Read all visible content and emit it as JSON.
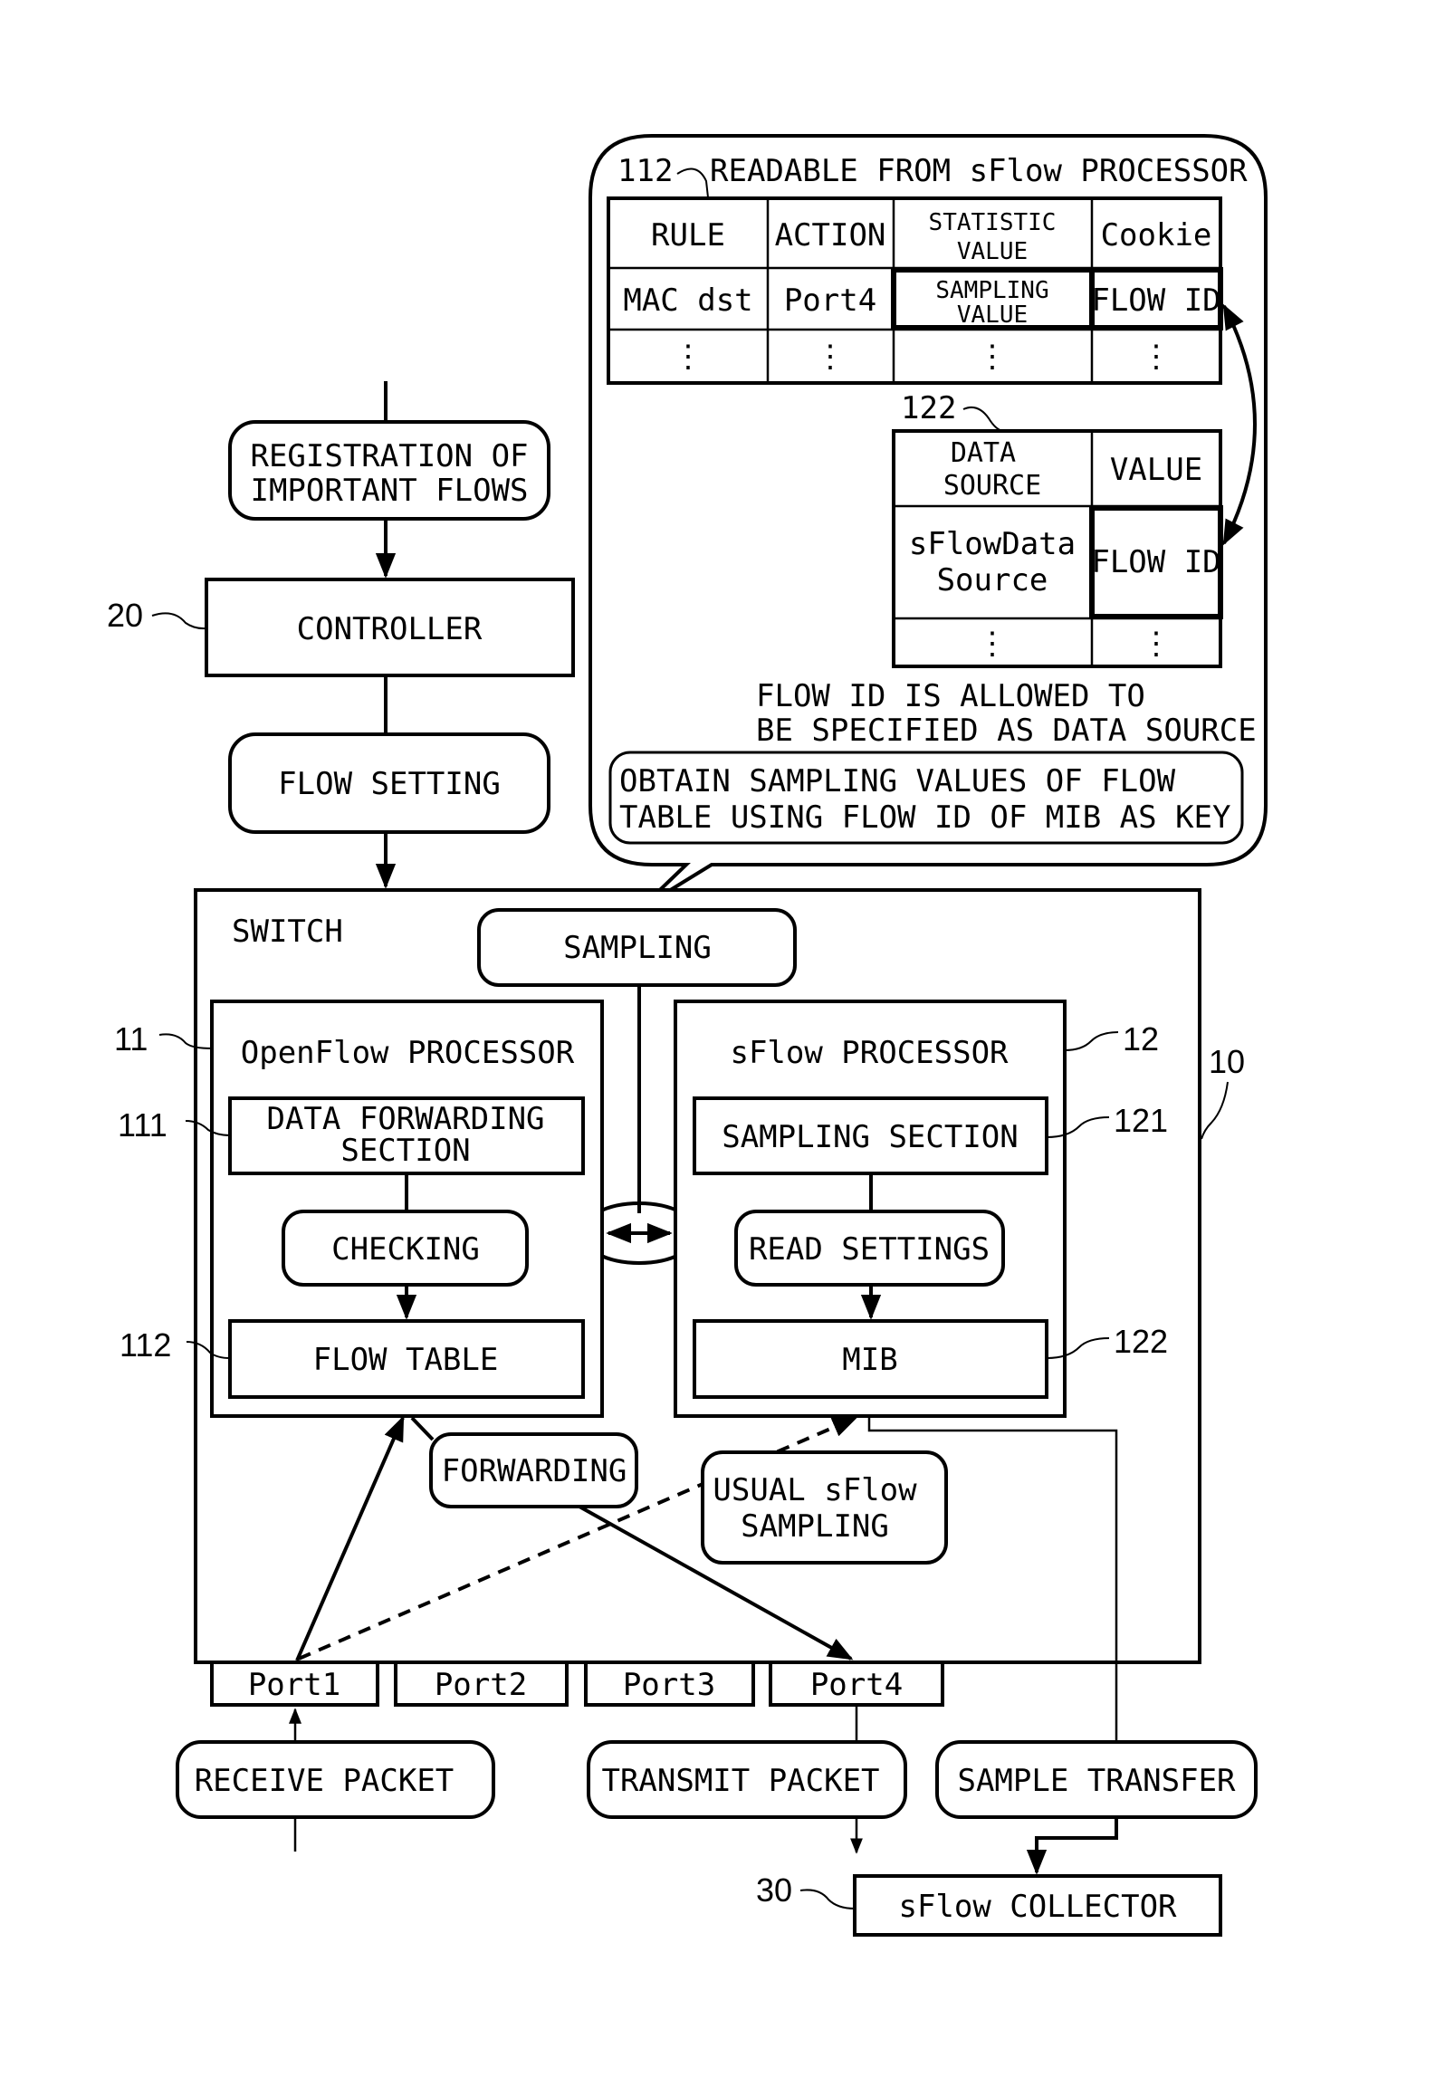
{
  "figure": {
    "bubble": {
      "ref_flow_table": "112",
      "title": "READABLE FROM sFlow PROCESSOR",
      "flow_table": {
        "headers": [
          [
            "RULE"
          ],
          [
            "ACTION"
          ],
          [
            "STATISTIC",
            "VALUE"
          ],
          [
            "Cookie"
          ]
        ],
        "row1": [
          [
            "MAC dst"
          ],
          [
            "Port4"
          ],
          [
            "SAMPLING",
            "VALUE"
          ],
          [
            "FLOW ID"
          ]
        ],
        "ellipsis": "⋮"
      },
      "ref_mib": "122",
      "mib_table": {
        "headers": [
          [
            "DATA",
            "SOURCE"
          ],
          [
            "VALUE"
          ]
        ],
        "row1": [
          [
            "sFlowData",
            "Source"
          ],
          [
            "FLOW ID"
          ]
        ],
        "ellipsis": "⋮"
      },
      "note_lines": [
        "FLOW ID IS ALLOWED TO",
        "BE SPECIFIED AS DATA SOURCE"
      ],
      "obtain_lines": [
        "OBTAIN SAMPLING VALUES OF FLOW",
        "TABLE USING FLOW ID OF MIB AS KEY"
      ]
    },
    "registration_lines": [
      "REGISTRATION OF",
      "IMPORTANT FLOWS"
    ],
    "controller": {
      "ref": "20",
      "label": "CONTROLLER"
    },
    "flow_setting": "FLOW SETTING",
    "switch": {
      "ref": "10",
      "label": "SWITCH",
      "sampling": "SAMPLING",
      "openflow": {
        "ref": "11",
        "label": "OpenFlow PROCESSOR",
        "data_forwarding_ref": "111",
        "data_forwarding_lines": [
          "DATA FORWARDING",
          "SECTION"
        ],
        "checking": "CHECKING",
        "flow_table_ref": "112",
        "flow_table": "FLOW TABLE"
      },
      "sflow": {
        "ref": "12",
        "label": "sFlow PROCESSOR",
        "sampling_section_ref": "121",
        "sampling_section": "SAMPLING SECTION",
        "read_settings": "READ SETTINGS",
        "mib_ref": "122",
        "mib": "MIB"
      },
      "forwarding": "FORWARDING",
      "usual_sflow_lines": [
        "USUAL sFlow",
        "SAMPLING"
      ],
      "ports": [
        "Port1",
        "Port2",
        "Port3",
        "Port4"
      ]
    },
    "receive_packet": "RECEIVE PACKET",
    "transmit_packet": "TRANSMIT PACKET",
    "sample_transfer": "SAMPLE TRANSFER",
    "collector": {
      "ref": "30",
      "label": "sFlow COLLECTOR"
    }
  }
}
